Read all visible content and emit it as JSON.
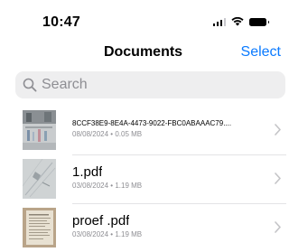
{
  "status_bar": {
    "time": "10:47"
  },
  "nav": {
    "title": "Documents",
    "select_label": "Select"
  },
  "search": {
    "placeholder": "Search"
  },
  "files": [
    {
      "name": "8CCF38E9-8E4A-4473-9022-FBC0ABAAAC79....",
      "date": "08/08/2024",
      "size": "0.05 MB"
    },
    {
      "name": "1.pdf",
      "date": "03/08/2024",
      "size": "1.19 MB"
    },
    {
      "name": "proef .pdf",
      "date": "03/08/2024",
      "size": "1.19 MB"
    }
  ],
  "meta_separator": "•",
  "colors": {
    "accent": "#0a7aff",
    "secondary_text": "#8e8e93",
    "search_bg": "#eeeeef"
  },
  "icons": [
    "signal-icon",
    "wifi-icon",
    "battery-icon",
    "search-icon",
    "chevron-right-icon"
  ]
}
